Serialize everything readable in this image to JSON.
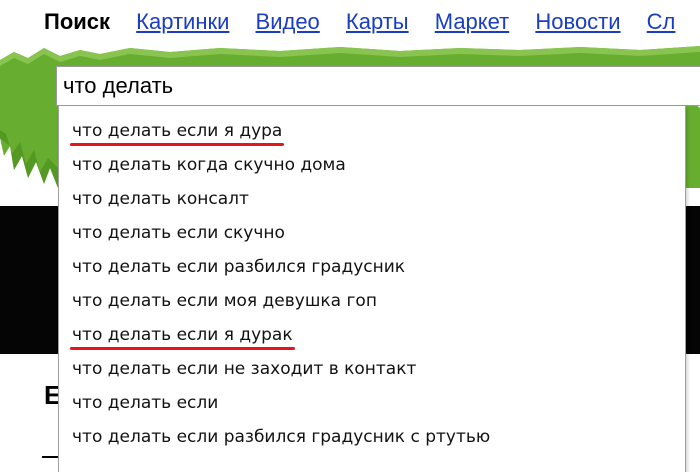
{
  "nav": {
    "items": [
      {
        "label": "Поиск"
      },
      {
        "label": "Картинки"
      },
      {
        "label": "Видео"
      },
      {
        "label": "Карты"
      },
      {
        "label": "Маркет"
      },
      {
        "label": "Новости"
      },
      {
        "label": "Сл"
      }
    ]
  },
  "search": {
    "value": "что делать"
  },
  "suggestions": [
    {
      "text": "что делать если я дура",
      "underlined": true
    },
    {
      "text": "что делать когда скучно дома",
      "underlined": false
    },
    {
      "text": "что делать консалт",
      "underlined": false
    },
    {
      "text": "что делать если скучно",
      "underlined": false
    },
    {
      "text": "что делать если разбился градусник",
      "underlined": false
    },
    {
      "text": "что делать если моя девушка гоп",
      "underlined": false
    },
    {
      "text": "что делать если я дурак",
      "underlined": true
    },
    {
      "text": "что делать если не заходит в контакт",
      "underlined": false
    },
    {
      "text": "что делать если",
      "underlined": false
    },
    {
      "text": "что делать если разбился градусник с ртутью",
      "underlined": false
    }
  ],
  "background_fragments": {
    "left_letter": "Е"
  },
  "colors": {
    "link": "#1a3dc1",
    "grass": "#67ad2f",
    "underline_mark": "#e8141c"
  }
}
